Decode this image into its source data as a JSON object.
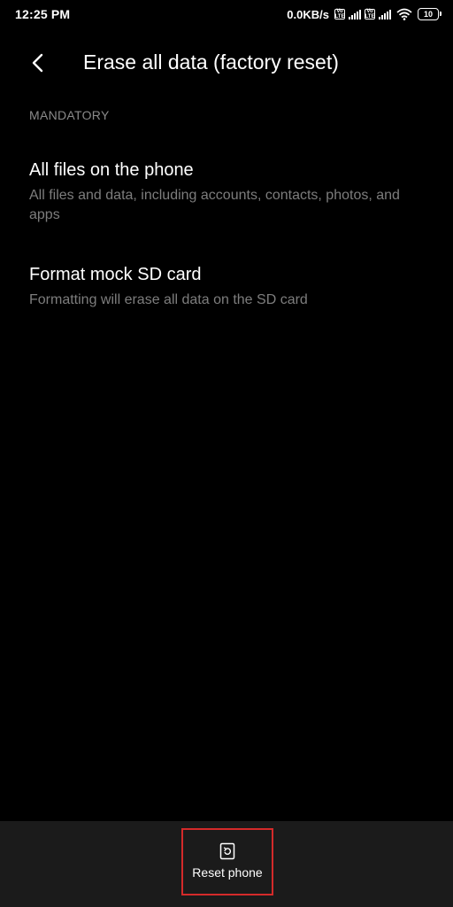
{
  "status_bar": {
    "time": "12:25 PM",
    "network_speed": "0.0KB/s",
    "volte_badge": "Vo LTE",
    "battery_level": "10",
    "icons": [
      "volte-icon",
      "signal-icon",
      "volte-icon",
      "signal-icon",
      "wifi-icon",
      "battery-icon"
    ]
  },
  "app_bar": {
    "title": "Erase all data (factory reset)",
    "back_icon": "chevron-left-icon"
  },
  "section": {
    "header": "MANDATORY"
  },
  "items": [
    {
      "title": "All files on the phone",
      "subtitle": "All files and data, including accounts, contacts, photos, and apps"
    },
    {
      "title": "Format mock SD card",
      "subtitle": "Formatting will erase all data on the SD card"
    }
  ],
  "bottom_bar": {
    "reset_label": "Reset phone",
    "reset_icon": "reset-phone-icon"
  },
  "colors": {
    "background": "#000000",
    "bottom_bar": "#1b1b1b",
    "secondary_text": "#7d7d7d",
    "highlight_border": "#d42a2a"
  }
}
